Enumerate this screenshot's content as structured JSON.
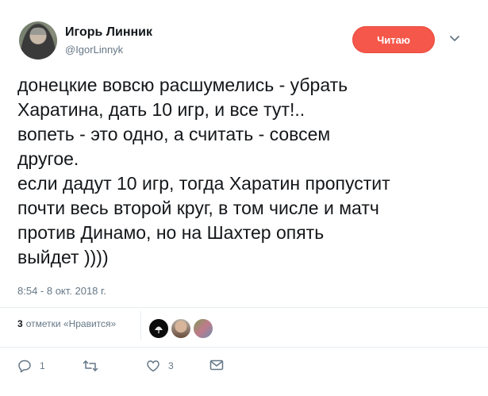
{
  "author": {
    "name": "Игорь Линник",
    "handle": "@IgorLinnyk"
  },
  "follow_button": {
    "label": "Читаю"
  },
  "tweet": {
    "text": "донецкие вовсю расшумелись - убрать\nХаратина, дать 10 игр, и все тут!..\nвопеть - это одно, а считать - совсем\nдругое.\nесли дадут 10 игр, тогда Харатин пропустит\nпочти весь второй круг, в том числе и матч\nпротив Динамо, но на Шахтер опять\nвыйдет ))))",
    "timestamp": "8:54 - 8 окт. 2018 г."
  },
  "likes": {
    "count": "3",
    "label": "отметки «Нравится»"
  },
  "actions": {
    "reply_count": "1",
    "retweet_count": "",
    "like_count": "3"
  },
  "colors": {
    "follow_button": "#f5574a",
    "secondary_text": "#657786",
    "divider": "#e6ecf0"
  },
  "icons": [
    "reply-icon",
    "retweet-icon",
    "heart-icon",
    "direct-message-icon",
    "chevron-down-icon"
  ]
}
